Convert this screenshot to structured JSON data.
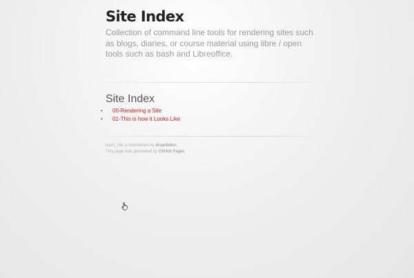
{
  "header": {
    "title": "Site Index",
    "description": "Collection of command line tools for rendering sites such as blogs, diaries, or course material using libre / open tools such as bash and Libreoffice."
  },
  "main": {
    "heading": "Site Index",
    "links": [
      {
        "label": "00-Rendering a Site"
      },
      {
        "label": "01-This is how it Looks Like"
      }
    ],
    "bullet": "•"
  },
  "footer": {
    "line1_prefix": "bash_site is maintained by ",
    "maintainer": "dcuartielles",
    "line2_prefix": "This page was generated by ",
    "generator": "GitHub Pages",
    "line2_suffix": "."
  },
  "colors": {
    "link": "#cc1f1f",
    "title": "#222222",
    "description": "#9a9a9a"
  },
  "icons": {
    "cursor": "hand-pointer-icon"
  }
}
